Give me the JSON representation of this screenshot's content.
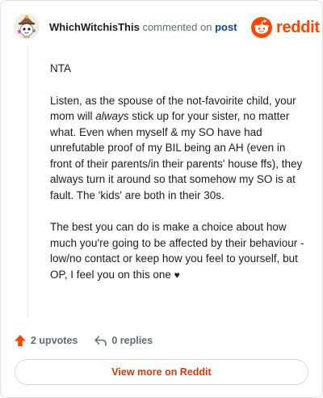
{
  "header": {
    "username": "WhichWitchisThis",
    "action_text": "commented on",
    "post_link": "post",
    "brand": "reddit"
  },
  "comment": {
    "paragraphs": [
      {
        "text": "NTA"
      },
      {
        "before": "Listen, as the spouse of the not-favoirite child, your mom will ",
        "emphasis": "always",
        "after": " stick up for your sister, no matter what. Even when myself & my SO have had unrefutable proof of my BIL being an AH (even in front of their parents/in their parents' house ffs), they always turn it around so that somehow my SO is at fault. The 'kids' are both in their 30s."
      },
      {
        "text": "The best you can do is make a choice about how much you're going to be affected by their behaviour - low/no contact or keep how you feel to yourself, but OP, I feel you on this one",
        "suffix": "♥"
      }
    ]
  },
  "footer": {
    "upvotes": "2 upvotes",
    "replies": "0 replies",
    "view_more": "View more on Reddit"
  },
  "colors": {
    "upvote": "#ff4500",
    "brand": "#ff4500",
    "link": "#0a449b",
    "view_more": "#d93a00"
  },
  "icons": {
    "avatar": "avatar-icon",
    "logo": "reddit-logo-icon",
    "upvote": "upvote-arrow-icon",
    "reply": "reply-arrow-icon"
  }
}
